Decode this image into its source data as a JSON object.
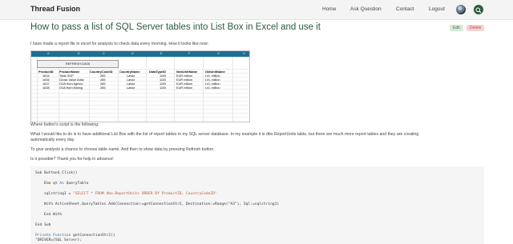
{
  "header": {
    "brand": "Thread Fusion",
    "nav": [
      "Home",
      "Ask Question",
      "Contact",
      "Logout"
    ]
  },
  "question": {
    "title": "How to pass a list of SQL Server tables into List Box in Excel and use it",
    "edit_label": "Edit",
    "delete_label": "Delete",
    "intro": "I have made a report file in excel for analysts to check data every morning. How it looks like now:",
    "p_button": "Where button's script is the following:",
    "p_want1": "What I would like to do is to have additional List Box with the list of report tables in my SQL server database. In my example it is dbo.ReportUnits table, but there are much more report tables and they are creating",
    "p_want2": "automatically every day.",
    "p_give": "To give analysts a chance to choose table name. And then to show data by pressing Refresh button.",
    "p_possible": "Is it possible? Thank you for help in advance!"
  },
  "sheet": {
    "columns": [
      "A",
      "B",
      "C",
      "D",
      "E",
      "F",
      "G",
      "H"
    ],
    "refresh_label": "REFRESH DATA",
    "headers": [
      "ProductID",
      "ProductName",
      "CountryCodeID",
      "CountryName",
      "DataTypeID",
      "NewUnitName",
      "OldUnitName"
    ],
    "rows": [
      [
        "1634",
        "Total GDP",
        "285",
        "Latvia",
        "1105",
        "EUR million",
        "LVL million"
      ],
      [
        "1636",
        "Gross Value Addc",
        "285",
        "Latvia",
        "1105",
        "EUR million",
        "LVL million"
      ],
      [
        "1637",
        "GVA from Agricul",
        "285",
        "Latvia",
        "1105",
        "EUR million",
        "LVL million"
      ],
      [
        "1638",
        "GVA from Mining",
        "285",
        "Latvia",
        "1105",
        "EUR million",
        "LVL million"
      ]
    ]
  },
  "code": {
    "l1": "Sub Button4_Click()",
    "l2a": "Dim qt ",
    "l2b": "As",
    "l2c": " QueryTable",
    "l3a": "sqlstring1 = ",
    "l3b": "\"SELECT * FROM dbo.ReportUnits ORDER BY ProductID, CountryCodeID\"",
    "l4": "With ActiveSheet.QueryTables.Add(Connection:=getConnectionStr2, Destination:=Range(\"A3\"), Sql:=sqlstring1)",
    "l5": "End With",
    "l6": "End Sub",
    "l7a": "Private Function",
    "l7b": " getConnectionStr2()",
    "l8": "\"DRIVER={SQL Server};"
  }
}
